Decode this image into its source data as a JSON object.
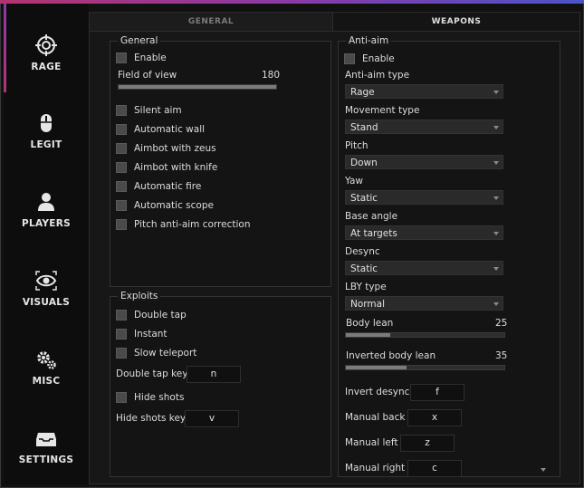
{
  "sidebar": {
    "items": [
      {
        "label": "RAGE",
        "icon": "crosshair-icon"
      },
      {
        "label": "LEGIT",
        "icon": "mouse-icon"
      },
      {
        "label": "PLAYERS",
        "icon": "user-icon"
      },
      {
        "label": "VISUALS",
        "icon": "eye-icon"
      },
      {
        "label": "MISC",
        "icon": "gears-icon"
      },
      {
        "label": "SETTINGS",
        "icon": "inbox-icon"
      }
    ]
  },
  "tabs": {
    "general": "GENERAL",
    "weapons": "WEAPONS"
  },
  "general_group": {
    "title": "General",
    "enable": "Enable",
    "fov_label": "Field of view",
    "fov_value": "180",
    "fov_fraction": 1.0,
    "options": [
      "Silent aim",
      "Automatic wall",
      "Aimbot with zeus",
      "Aimbot with knife",
      "Automatic fire",
      "Automatic scope",
      "Pitch anti-aim correction"
    ]
  },
  "exploits_group": {
    "title": "Exploits",
    "double_tap": "Double tap",
    "instant": "Instant",
    "slow_teleport": "Slow teleport",
    "double_tap_key_label": "Double tap key",
    "double_tap_key": "n",
    "hide_shots": "Hide shots",
    "hide_shots_key_label": "Hide shots key",
    "hide_shots_key": "v"
  },
  "antiaim_group": {
    "title": "Anti-aim",
    "enable": "Enable",
    "fields": [
      {
        "label": "Anti-aim type",
        "value": "Rage"
      },
      {
        "label": "Movement type",
        "value": "Stand"
      },
      {
        "label": "Pitch",
        "value": "Down"
      },
      {
        "label": "Yaw",
        "value": "Static"
      },
      {
        "label": "Base angle",
        "value": "At targets"
      },
      {
        "label": "Desync",
        "value": "Static"
      },
      {
        "label": "LBY type",
        "value": "Normal"
      }
    ],
    "body_lean_label": "Body lean",
    "body_lean_value": "25",
    "body_lean_fraction": 0.28,
    "inverted_body_lean_label": "Inverted body lean",
    "inverted_body_lean_value": "35",
    "inverted_body_lean_fraction": 0.38,
    "keys": [
      {
        "label": "Invert desync",
        "value": "f"
      },
      {
        "label": "Manual back",
        "value": "x"
      },
      {
        "label": "Manual left",
        "value": "z"
      },
      {
        "label": "Manual right",
        "value": "c"
      }
    ]
  }
}
